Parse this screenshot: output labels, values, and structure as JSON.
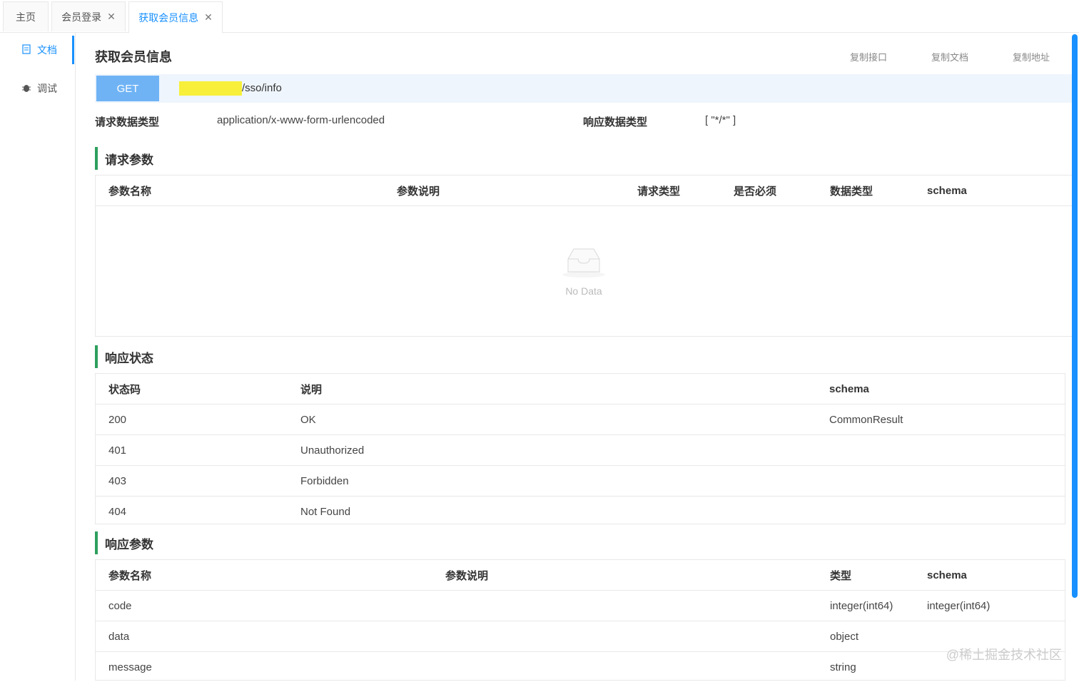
{
  "tabs": [
    {
      "label": "主页",
      "closable": false
    },
    {
      "label": "会员登录",
      "closable": true
    },
    {
      "label": "获取会员信息",
      "closable": true,
      "active": true
    }
  ],
  "sidebar": {
    "items": [
      {
        "label": "文档",
        "icon": "document-icon",
        "active": true
      },
      {
        "label": "调试",
        "icon": "bug-icon",
        "active": false
      }
    ]
  },
  "page": {
    "title": "获取会员信息",
    "copy_links": [
      "复制接口",
      "复制文档",
      "复制地址"
    ]
  },
  "endpoint": {
    "method": "GET",
    "path": "/sso/info"
  },
  "meta": {
    "request_type_label": "请求数据类型",
    "request_type_value": "application/x-www-form-urlencoded",
    "response_type_label": "响应数据类型",
    "response_type_value": "[ \"*/*\" ]"
  },
  "request_params": {
    "heading": "请求参数",
    "columns": [
      "参数名称",
      "参数说明",
      "请求类型",
      "是否必须",
      "数据类型",
      "schema"
    ],
    "empty_text": "No Data"
  },
  "response_status": {
    "heading": "响应状态",
    "columns": [
      "状态码",
      "说明",
      "schema"
    ],
    "rows": [
      [
        "200",
        "OK",
        "CommonResult"
      ],
      [
        "401",
        "Unauthorized",
        ""
      ],
      [
        "403",
        "Forbidden",
        ""
      ],
      [
        "404",
        "Not Found",
        ""
      ]
    ]
  },
  "response_params": {
    "heading": "响应参数",
    "columns": [
      "参数名称",
      "参数说明",
      "类型",
      "schema"
    ],
    "rows": [
      [
        "code",
        "",
        "integer(int64)",
        "integer(int64)"
      ],
      [
        "data",
        "",
        "object",
        ""
      ],
      [
        "message",
        "",
        "string",
        ""
      ]
    ]
  },
  "watermark": "@稀土掘金技术社区",
  "colors": {
    "accent": "#1890ff",
    "section_bar": "#2e9f5e",
    "get_button": "#6fb3f5",
    "highlight": "#f7ef3a"
  }
}
